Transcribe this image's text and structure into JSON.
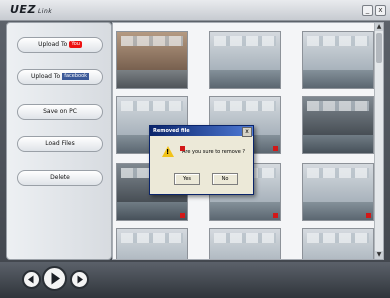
{
  "app": {
    "title": "UEZ",
    "subtitle": "Link"
  },
  "window": {
    "minimize": "_",
    "close": "x"
  },
  "sidebar": {
    "upload_youtube": {
      "label": "Upload To",
      "badge": "You"
    },
    "upload_facebook": {
      "label": "Upload To",
      "badge": "facebook"
    },
    "save_pc": "Save on PC",
    "load_files": "Load Files",
    "delete": "Delete"
  },
  "dialog": {
    "title": "Removed file",
    "message": "Are you sure to remove ?",
    "yes": "Yes",
    "no": "No",
    "close": "x"
  },
  "scrollbar": {
    "up": "▲",
    "down": "▼"
  }
}
